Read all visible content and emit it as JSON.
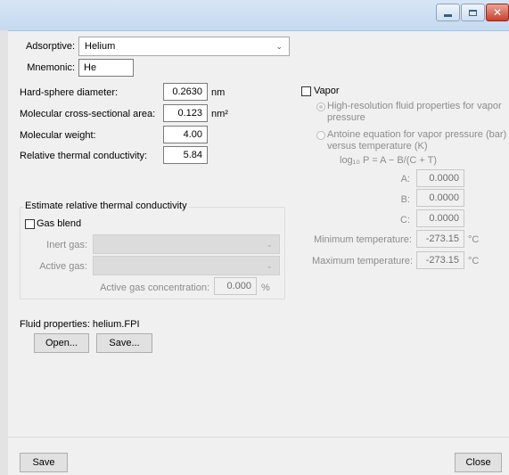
{
  "window": {
    "buttons": [
      "minimize-icon",
      "maximize-icon",
      "close-icon"
    ],
    "close_glyph": "✕"
  },
  "adsorptive": {
    "label": "Adsorptive:",
    "value": "Helium",
    "mnemonic_label": "Mnemonic:",
    "mnemonic_value": "He"
  },
  "properties": {
    "hard_sphere_label": "Hard-sphere diameter:",
    "hard_sphere_value": "0.2630",
    "hard_sphere_unit": "nm",
    "cross_section_label": "Molecular cross-sectional area:",
    "cross_section_value": "0.123",
    "cross_section_unit": "nm²",
    "molecular_weight_label": "Molecular weight:",
    "molecular_weight_value": "4.00",
    "thermal_cond_label": "Relative thermal conductivity:",
    "thermal_cond_value": "5.84"
  },
  "vapor": {
    "checkbox_label": "Vapor",
    "option1_line1": "High-resolution fluid properties for vapor",
    "option1_line2": "pressure",
    "option2_line1": "Antoine equation for vapor pressure (bar)",
    "option2_line2": "versus temperature (K)",
    "equation": "log₁₀ P = A − B/(C + T)",
    "a_label": "A:",
    "a_value": "0.0000",
    "b_label": "B:",
    "b_value": "0.0000",
    "c_label": "C:",
    "c_value": "0.0000",
    "min_temp_label": "Minimum temperature:",
    "min_temp_value": "-273.15",
    "max_temp_label": "Maximum temperature:",
    "max_temp_value": "-273.15",
    "temp_unit": "°C"
  },
  "estimate": {
    "group_title": "Estimate relative thermal conductivity",
    "gas_blend_label": "Gas blend",
    "inert_gas_label": "Inert gas:",
    "active_gas_label": "Active gas:",
    "concentration_label": "Active gas concentration:",
    "concentration_value": "0.000",
    "concentration_unit": "%"
  },
  "fluid": {
    "label": "Fluid properties: helium.FPI",
    "open_button": "Open...",
    "save_button": "Save..."
  },
  "footer": {
    "save_button": "Save",
    "close_button": "Close"
  }
}
